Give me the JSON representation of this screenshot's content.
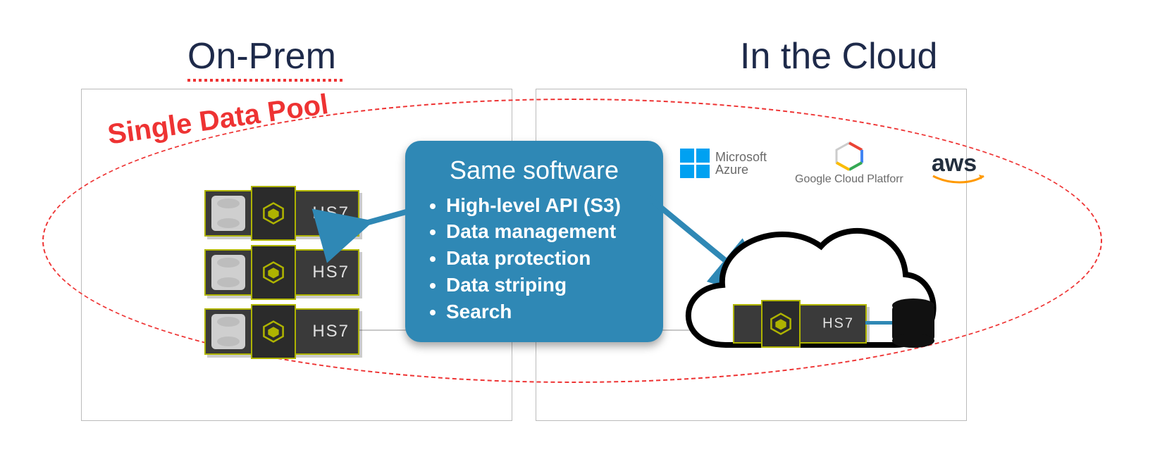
{
  "titles": {
    "left": "On-Prem",
    "right": "In the Cloud"
  },
  "poolLabel": "Single Data Pool",
  "callout": {
    "title": "Same software",
    "items": [
      "High-level API (S3)",
      "Data management",
      "Data protection",
      "Data striping",
      "Search"
    ]
  },
  "units": {
    "onprem": [
      {
        "label": "HS7"
      },
      {
        "label": "HS7"
      },
      {
        "label": "HS7"
      }
    ],
    "cloud": {
      "label": "HS7"
    }
  },
  "providers": {
    "azure": {
      "line1": "Microsoft",
      "line2": "Azure"
    },
    "gcp": {
      "label": "Google Cloud Platforr"
    },
    "aws": {
      "label": "aws"
    }
  },
  "colors": {
    "accentBlue": "#2f88b5",
    "dashRed": "#e33333",
    "unitGreen": "#aeb300",
    "titleNavy": "#1e2a4a"
  }
}
